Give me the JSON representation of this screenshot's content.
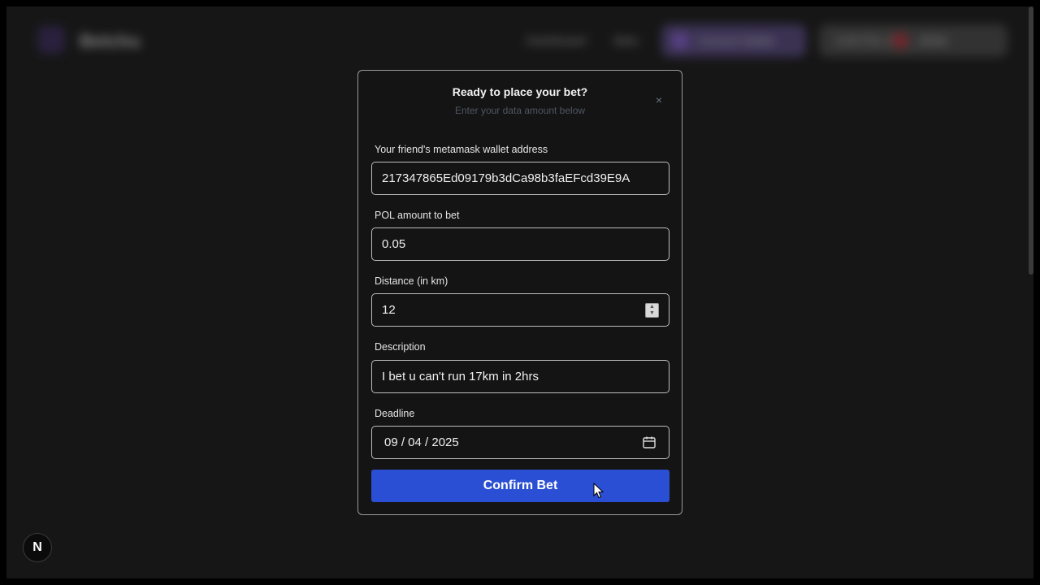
{
  "background": {
    "brand": "Betchu",
    "nav": [
      "Dashboard",
      "Bets"
    ],
    "wallet_button": "Connect Wallet",
    "account_button": "0.05 POL 0x21...9E9A"
  },
  "dialog": {
    "title": "Ready to place your bet?",
    "subtitle": "Enter your data amount below",
    "close_icon": "×"
  },
  "form": {
    "wallet_label": "Your friend's metamask wallet address",
    "wallet_value": "217347865Ed09179b3dCa98b3faEFcd39E9A",
    "amount_label": "POL amount to bet",
    "amount_value": "0.05",
    "distance_label": "Distance (in km)",
    "distance_value": "12",
    "description_label": "Description",
    "description_value": "I bet u can't run 17km in 2hrs",
    "deadline_label": "Deadline",
    "deadline_value": "09 / 04 / 2025",
    "confirm_label": "Confirm Bet"
  },
  "next_badge": "N",
  "colors": {
    "accent": "#2b4fd4",
    "dialog_bg": "#141414",
    "page_bg": "#161616"
  }
}
